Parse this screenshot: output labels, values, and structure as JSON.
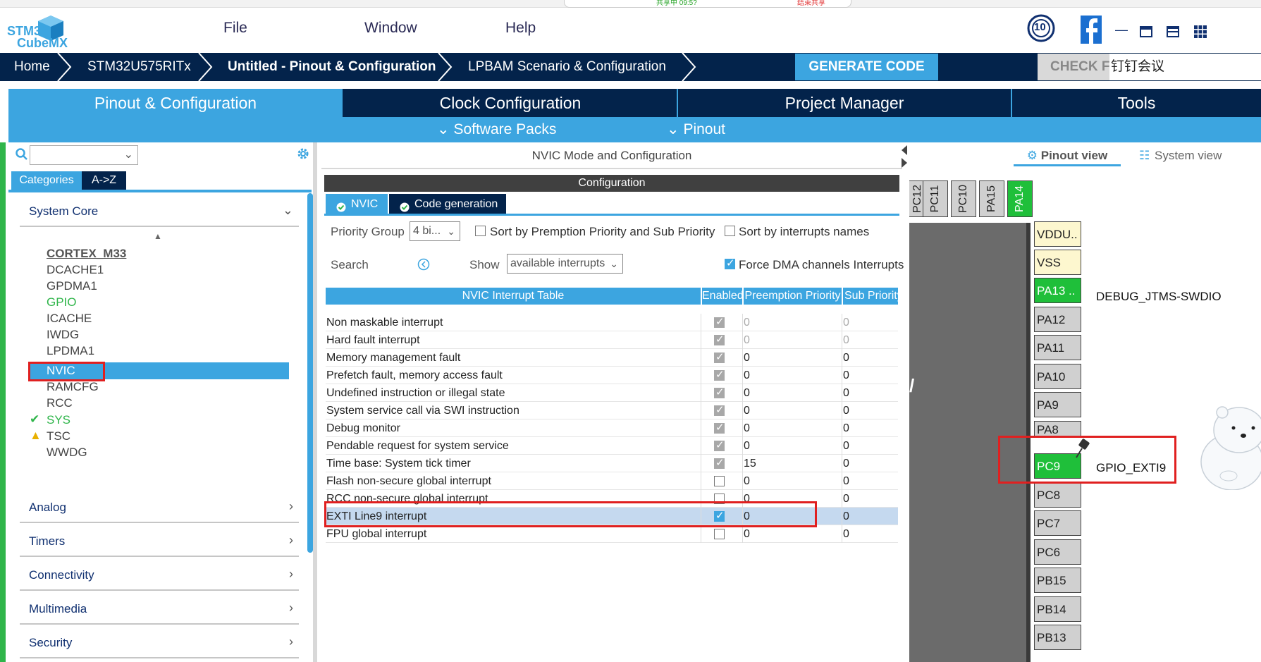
{
  "floatbar": {
    "sharing": "共享中 09:5?",
    "stop": "结束共享"
  },
  "logo": {
    "line1": "STM32",
    "line2": "CubeMX"
  },
  "menu": [
    "File",
    "Window",
    "Help"
  ],
  "breadcrumb": [
    "Home",
    "STM32U575RITx",
    "Untitled - Pinout & Configuration",
    "LPBAM Scenario & Configuration"
  ],
  "generate": "GENERATE CODE",
  "check": "CHECK FOR UPDATES",
  "dingtalk": "钉钉会议",
  "badge": "10",
  "tabs": [
    "Pinout & Configuration",
    "Clock Configuration",
    "Project Manager",
    "Tools"
  ],
  "subtabs": [
    "Software Packs",
    "Pinout"
  ],
  "left": {
    "categories": "Categories",
    "az": "A->Z",
    "sections": [
      "System Core",
      "Analog",
      "Timers",
      "Connectivity",
      "Multimedia",
      "Security"
    ],
    "items": [
      "CORTEX_M33",
      "DCACHE1",
      "GPDMA1",
      "GPIO",
      "ICACHE",
      "IWDG",
      "LPDMA1",
      "NVIC",
      "RAMCFG",
      "RCC",
      "SYS",
      "TSC",
      "WWDG"
    ]
  },
  "mid": {
    "title": "NVIC Mode and Configuration",
    "config": "Configuration",
    "tab_nvic": "NVIC",
    "tab_codegen": "Code generation",
    "priority_group_label": "Priority Group",
    "priority_group_value": "4 bi...",
    "sort_priority": "Sort by Premption Priority and Sub Priority",
    "sort_names": "Sort by interrupts names",
    "search_label": "Search",
    "show_label": "Show",
    "show_value": "available interrupts",
    "force_dma": "Force DMA channels Interrupts",
    "headers": [
      "NVIC Interrupt Table",
      "Enabled",
      "Preemption Priority",
      "Sub Priority"
    ],
    "rows": [
      {
        "name": "Non maskable interrupt",
        "p": "0",
        "s": "0"
      },
      {
        "name": "Hard fault interrupt",
        "p": "0",
        "s": "0"
      },
      {
        "name": "Memory management fault",
        "p": "0",
        "s": "0"
      },
      {
        "name": "Prefetch fault, memory access fault",
        "p": "0",
        "s": "0"
      },
      {
        "name": "Undefined instruction or illegal state",
        "p": "0",
        "s": "0"
      },
      {
        "name": "System service call via SWI instruction",
        "p": "0",
        "s": "0"
      },
      {
        "name": "Debug monitor",
        "p": "0",
        "s": "0"
      },
      {
        "name": "Pendable request for system service",
        "p": "0",
        "s": "0"
      },
      {
        "name": "Time base: System tick timer",
        "p": "15",
        "s": "0"
      },
      {
        "name": "Flash non-secure global interrupt",
        "p": "0",
        "s": "0"
      },
      {
        "name": "RCC non-secure global interrupt",
        "p": "0",
        "s": "0"
      },
      {
        "name": "EXTI Line9 interrupt",
        "p": "0",
        "s": "0"
      },
      {
        "name": "FPU global interrupt",
        "p": "0",
        "s": "0"
      }
    ]
  },
  "right": {
    "pinout_view": "Pinout view",
    "system_view": "System view",
    "top_pins": [
      "PC12",
      "PC11",
      "PC10",
      "PA15",
      "PA14"
    ],
    "pins": [
      "VDDU..",
      "VSS",
      "PA13 ..",
      "PA12",
      "PA11",
      "PA10",
      "PA9",
      "PA8",
      "PC9",
      "PC8",
      "PC7",
      "PC6",
      "PB15",
      "PB14",
      "PB13"
    ],
    "label_pa13": "DEBUG_JTMS-SWDIO",
    "label_pc9": "GPIO_EXTI9"
  }
}
